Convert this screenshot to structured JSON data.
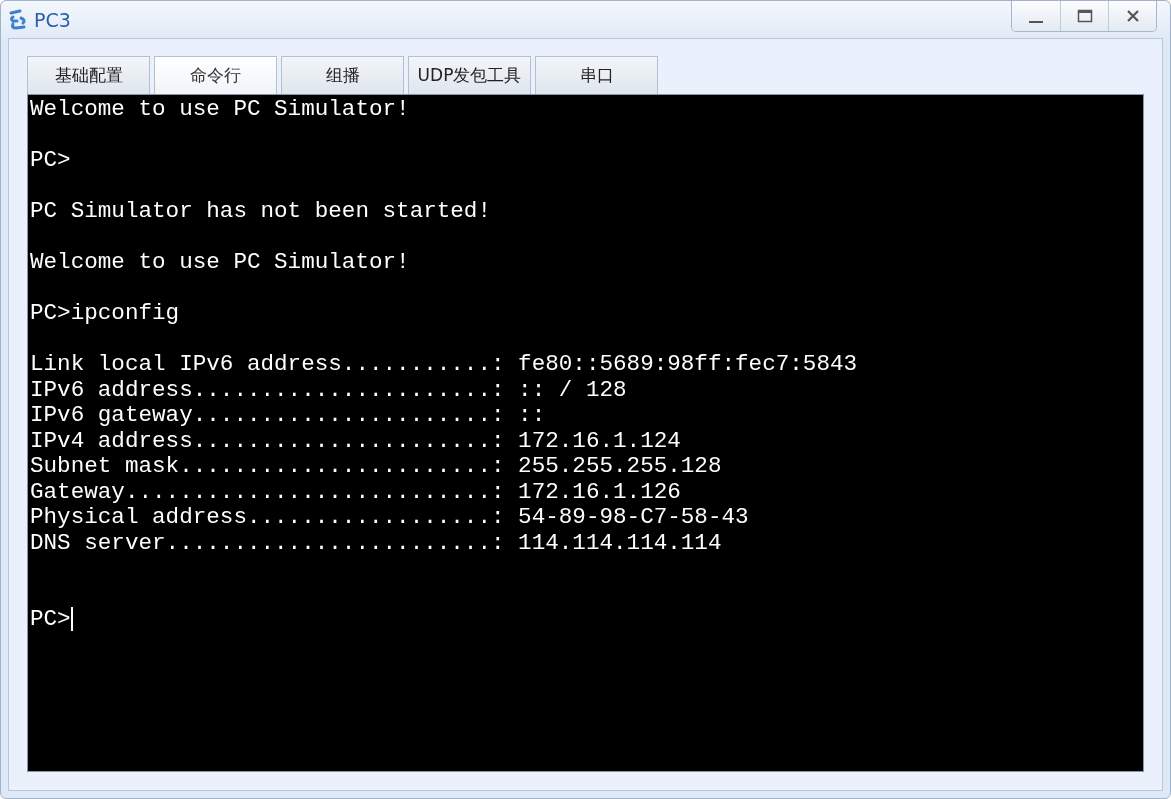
{
  "window": {
    "title": "PC3"
  },
  "tabs": [
    {
      "label": "基础配置",
      "selected": false
    },
    {
      "label": "命令行",
      "selected": true
    },
    {
      "label": "组播",
      "selected": false
    },
    {
      "label": "UDP发包工具",
      "selected": false
    },
    {
      "label": "串口",
      "selected": false
    }
  ],
  "terminal": {
    "lines": [
      {
        "kind": "text",
        "text": "Welcome to use PC Simulator!"
      },
      {
        "kind": "blank"
      },
      {
        "kind": "text",
        "text": "PC>"
      },
      {
        "kind": "blank"
      },
      {
        "kind": "text",
        "text": "PC Simulator has not been started!"
      },
      {
        "kind": "blank"
      },
      {
        "kind": "text",
        "text": "Welcome to use PC Simulator!"
      },
      {
        "kind": "blank"
      },
      {
        "kind": "text",
        "text": "PC>ipconfig"
      },
      {
        "kind": "blank"
      },
      {
        "kind": "text",
        "text": "Link local IPv6 address...........: fe80::5689:98ff:fec7:5843"
      },
      {
        "kind": "text",
        "text": "IPv6 address......................: :: / 128"
      },
      {
        "kind": "text",
        "text": "IPv6 gateway......................: ::"
      },
      {
        "kind": "text",
        "text": "IPv4 address......................: 172.16.1.124"
      },
      {
        "kind": "text",
        "text": "Subnet mask.......................: 255.255.255.128"
      },
      {
        "kind": "text",
        "text": "Gateway...........................: 172.16.1.126"
      },
      {
        "kind": "text",
        "text": "Physical address..................: 54-89-98-C7-58-43"
      },
      {
        "kind": "text",
        "text": "DNS server........................: 114.114.114.114"
      },
      {
        "kind": "blank"
      },
      {
        "kind": "blank"
      },
      {
        "kind": "prompt",
        "text": "PC>"
      }
    ]
  }
}
